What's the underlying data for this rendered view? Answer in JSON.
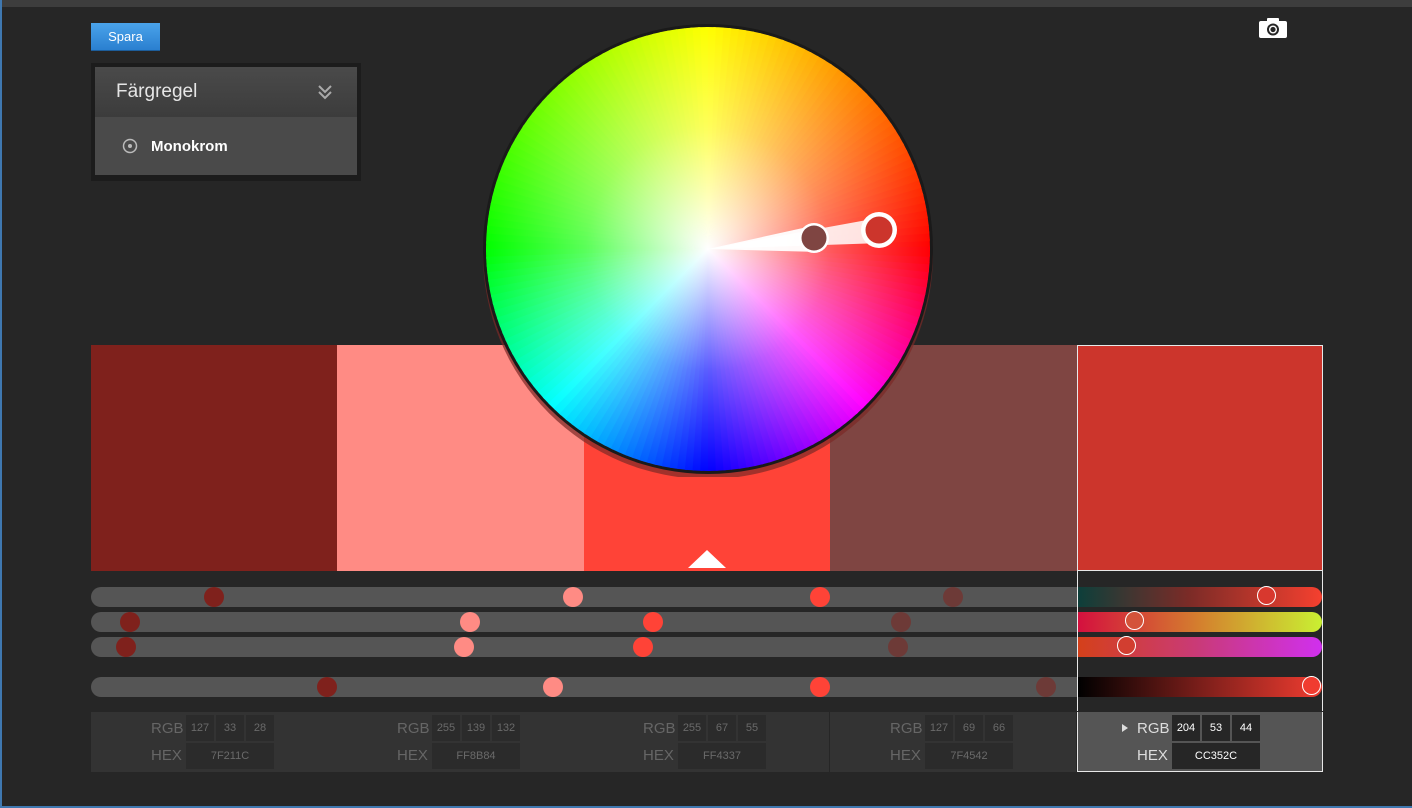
{
  "toolbar": {
    "save_label": "Spara"
  },
  "rule_panel": {
    "title": "Färgregel",
    "selected_rule": "Monokrom"
  },
  "swatches": [
    {
      "color": "#7F211C",
      "rgb": [
        "127",
        "33",
        "28"
      ],
      "hex": "7F211C",
      "rgb_label": "RGB",
      "hex_label": "HEX"
    },
    {
      "color": "#FF8B84",
      "rgb": [
        "255",
        "139",
        "132"
      ],
      "hex": "FF8B84",
      "rgb_label": "RGB",
      "hex_label": "HEX"
    },
    {
      "color": "#FF4337",
      "rgb": [
        "255",
        "67",
        "55"
      ],
      "hex": "FF4337",
      "rgb_label": "RGB",
      "hex_label": "HEX"
    },
    {
      "color": "#7F4542",
      "rgb": [
        "127",
        "69",
        "66"
      ],
      "hex": "7F4542",
      "rgb_label": "RGB",
      "hex_label": "HEX"
    },
    {
      "color": "#CC352C",
      "rgb": [
        "204",
        "53",
        "44"
      ],
      "hex": "CC352C",
      "rgb_label": "RGB",
      "hex_label": "HEX",
      "selected": true
    }
  ],
  "colors": {
    "accent": "#2a7fd0",
    "selected_base": "#CC352C",
    "base_handle": "#7F4542"
  },
  "icons": [
    "camera-icon",
    "chevron-down-double-icon",
    "radio-target-icon",
    "expand-triangle-icon"
  ]
}
